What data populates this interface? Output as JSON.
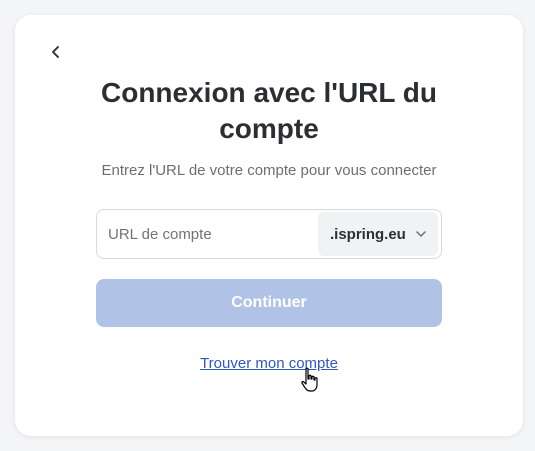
{
  "login": {
    "title": "Connexion avec l'URL du compte",
    "subtitle": "Entrez l'URL de votre compte pour vous connecter",
    "url_field": {
      "placeholder": "URL de compte",
      "value": ""
    },
    "domain_select": {
      "selected": ".ispring.eu"
    },
    "continue_label": "Continuer",
    "find_account_link": "Trouver mon compte"
  },
  "icons": {
    "back": "chevron-left-icon",
    "domain_dropdown": "chevron-down-icon",
    "cursor": "hand-pointer-cursor"
  },
  "colors": {
    "button_disabled": "#b0c3e6",
    "link": "#2f56c6",
    "title": "#2b2f33",
    "subtitle": "#6b6f75"
  }
}
